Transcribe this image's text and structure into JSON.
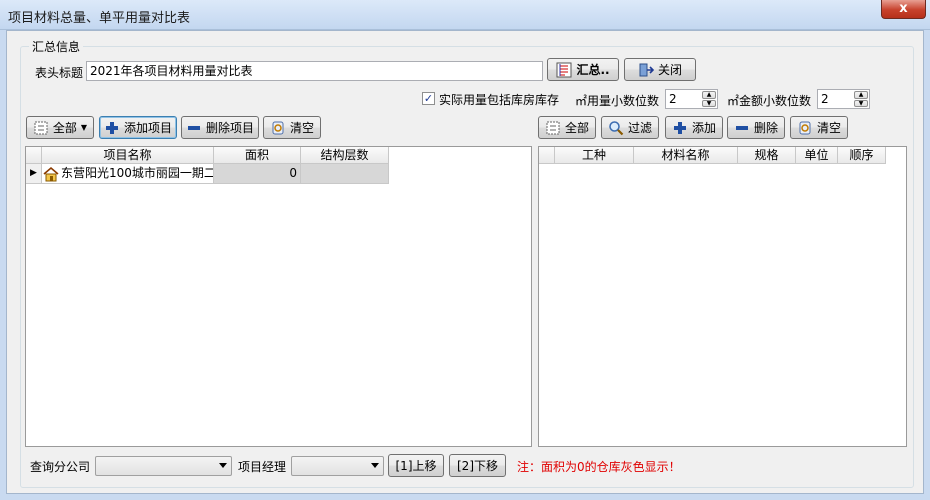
{
  "window": {
    "title": "项目材料总量、单平用量对比表",
    "close_glyph": "x"
  },
  "group": {
    "label": "汇总信息"
  },
  "header_title": {
    "label": "表头标题",
    "value": "2021年各项目材料用量对比表"
  },
  "buttons": {
    "summary": "汇总..",
    "close": "关闭",
    "left_all": "全部",
    "add_project": "添加项目",
    "delete_project": "删除项目",
    "left_clear": "清空",
    "right_all": "全部",
    "filter": "过滤",
    "add": "添加",
    "delete": "删除",
    "right_clear": "清空",
    "move_up": "[1]上移",
    "move_down": "[2]下移"
  },
  "options": {
    "include_warehouse_label": "实际用量包括库房库存",
    "include_warehouse_checked": true,
    "qty_decimals_label": "㎡用量小数位数",
    "qty_decimals_value": "2",
    "amount_decimals_label": "㎡金额小数位数",
    "amount_decimals_value": "2"
  },
  "left_grid": {
    "columns": [
      "项目名称",
      "面积",
      "结构层数"
    ],
    "rows": [
      {
        "name": "东营阳光100城市丽园一期二",
        "area": "0",
        "floors": ""
      }
    ]
  },
  "right_grid": {
    "columns": [
      "工种",
      "材料名称",
      "规格",
      "单位",
      "顺序"
    ]
  },
  "bottom": {
    "branch_label": "查询分公司",
    "branch_value": "",
    "manager_label": "项目经理",
    "manager_value": "",
    "note": "注：面积为0的仓库灰色显示！"
  }
}
